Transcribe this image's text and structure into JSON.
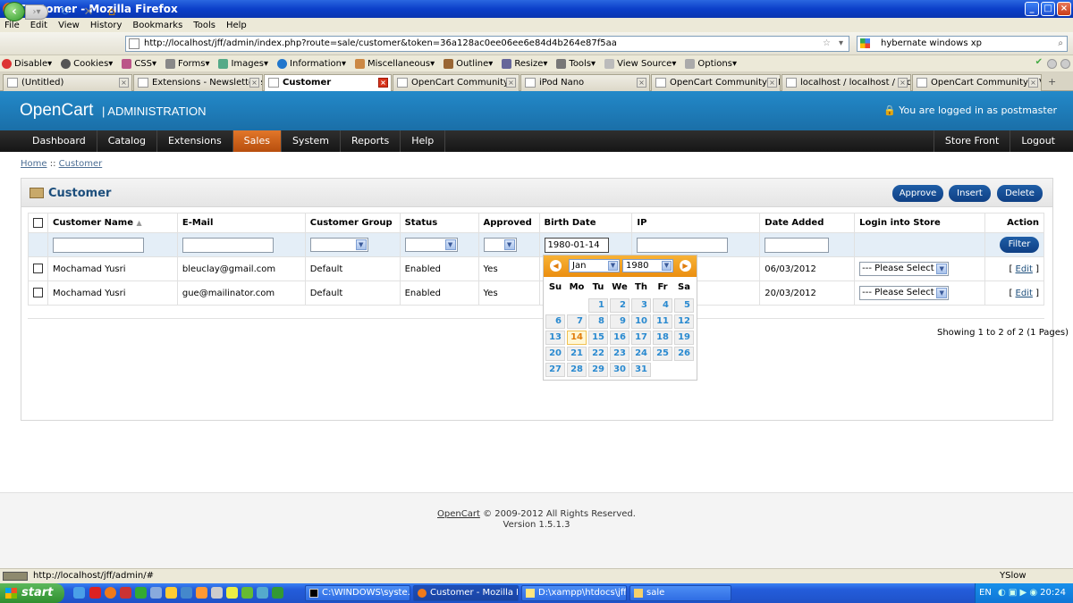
{
  "window": {
    "title": "Customer - Mozilla Firefox"
  },
  "menubar": [
    "File",
    "Edit",
    "View",
    "History",
    "Bookmarks",
    "Tools",
    "Help"
  ],
  "toolbar": {
    "url": "http://localhost/jff/admin/index.php?route=sale/customer&token=36a128ac0ee06ee6e84d4b264e87f5aa",
    "search": "hybernate windows xp"
  },
  "devbar": [
    "Disable",
    "Cookies",
    "CSS",
    "Forms",
    "Images",
    "Information",
    "Miscellaneous",
    "Outline",
    "Resize",
    "Tools",
    "View Source",
    "Options"
  ],
  "tabs": [
    {
      "label": "(Untitled)",
      "active": false
    },
    {
      "label": "Extensions - Newsletter su...",
      "active": false
    },
    {
      "label": "Customer",
      "active": true
    },
    {
      "label": "OpenCart Community • Vie...",
      "active": false
    },
    {
      "label": "iPod Nano",
      "active": false
    },
    {
      "label": "OpenCart Community • Pos...",
      "active": false
    },
    {
      "label": "localhost / localhost / jffdb ...",
      "active": false
    },
    {
      "label": "OpenCart Community • Vie...",
      "active": false
    }
  ],
  "header": {
    "logo": "OpenCart",
    "admin": "ADMINISTRATION",
    "login": "You are logged in as postmaster"
  },
  "nav": {
    "items": [
      "Dashboard",
      "Catalog",
      "Extensions",
      "Sales",
      "System",
      "Reports",
      "Help"
    ],
    "active": "Sales",
    "right": [
      "Store Front",
      "Logout"
    ]
  },
  "breadcrumb": {
    "home": "Home",
    "sep": " :: ",
    "current": "Customer"
  },
  "box": {
    "title": "Customer",
    "buttons": [
      "Approve",
      "Insert",
      "Delete"
    ]
  },
  "table": {
    "columns": [
      "Customer Name",
      "E-Mail",
      "Customer Group",
      "Status",
      "Approved",
      "Birth Date",
      "IP",
      "Date Added",
      "Login into Store",
      "Action"
    ],
    "sort_indicator": "▲",
    "filter": {
      "birth_date": "1980-01-14",
      "button": "Filter"
    },
    "rows": [
      {
        "name": "Mochamad Yusri",
        "email": "bleuclay@gmail.com",
        "group": "Default",
        "status": "Enabled",
        "approved": "Yes",
        "date_added": "06/03/2012",
        "login": "--- Please Select ---",
        "action": "[ Edit ]"
      },
      {
        "name": "Mochamad Yusri",
        "email": "gue@mailinator.com",
        "group": "Default",
        "status": "Enabled",
        "approved": "Yes",
        "date_added": "20/03/2012",
        "login": "--- Please Select ---",
        "action": "[ Edit ]"
      }
    ],
    "pagination": "Showing 1 to 2 of 2 (1 Pages)"
  },
  "datepicker": {
    "month": "Jan",
    "year": "1980",
    "weekdays": [
      "Su",
      "Mo",
      "Tu",
      "We",
      "Th",
      "Fr",
      "Sa"
    ],
    "first_weekday": 2,
    "days_in_month": 31,
    "selected_day": 14
  },
  "footer": {
    "link": "OpenCart",
    "text": " © 2009-2012 All Rights Reserved.",
    "version": "Version 1.5.1.3"
  },
  "statusbar": {
    "text": "http://localhost/jff/admin/#",
    "yslow": "YSlow"
  },
  "taskbar": {
    "start": "start",
    "tasks": [
      "C:\\WINDOWS\\syste...",
      "Customer - Mozilla Fir...",
      "D:\\xampp\\htdocs\\jff\\...",
      "sale"
    ],
    "lang": "EN",
    "clock": "20:24"
  }
}
